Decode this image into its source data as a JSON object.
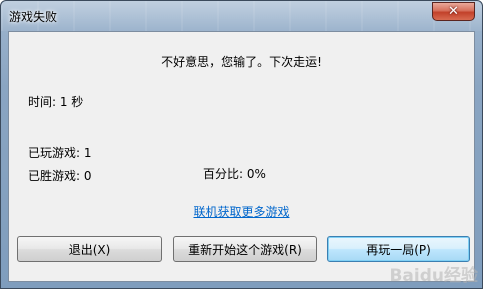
{
  "window": {
    "title": "游戏失败",
    "close_label": "✕"
  },
  "dialog": {
    "message": "不好意思，您输了。下次走运!",
    "time": "时间: 1 秒",
    "games_played": "已玩游戏: 1",
    "games_won": "已胜游戏: 0",
    "win_percentage": "百分比: 0%",
    "online_link": "联机获取更多游戏"
  },
  "buttons": {
    "exit": "退出(X)",
    "restart": "重新开始这个游戏(R)",
    "play_again": "再玩一局(P)"
  },
  "watermark": "Baidu经验"
}
